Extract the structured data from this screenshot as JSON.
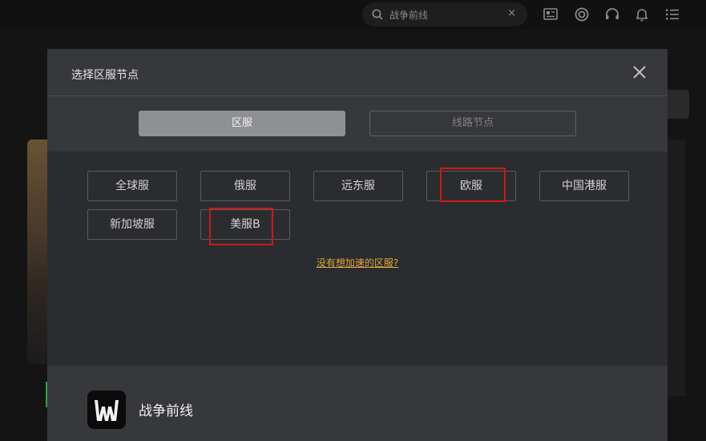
{
  "topbar": {
    "search": {
      "value": "战争前线",
      "clear": "×"
    },
    "icons": [
      "news-icon",
      "game-controller-icon",
      "headset-icon",
      "bell-icon",
      "menu-icon"
    ]
  },
  "modal": {
    "title": "选择区服节点",
    "close": "close-icon",
    "tabs": [
      {
        "label": "区服",
        "active": true
      },
      {
        "label": "线路节点",
        "active": false
      }
    ],
    "regions": [
      "全球服",
      "俄服",
      "远东服",
      "欧服",
      "中国港服",
      "新加坡服",
      "美服B"
    ],
    "highlighted": [
      "欧服",
      "美服B"
    ],
    "highlight_color": "#d01818",
    "hint": "没有想加速的区服?",
    "hint_color": "#e0a63a",
    "game": {
      "name": "战争前线"
    }
  }
}
